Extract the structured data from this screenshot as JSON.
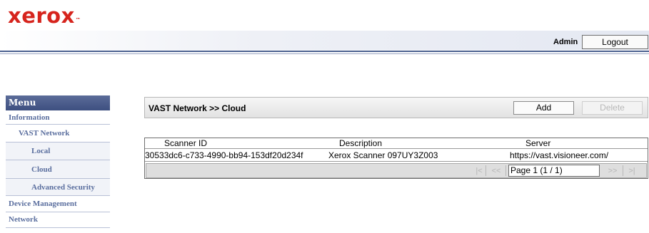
{
  "brand": {
    "logo_text": "xerox",
    "trademark": "™"
  },
  "header": {
    "user_label": "Admin",
    "logout_label": "Logout"
  },
  "sidebar": {
    "title": "Menu",
    "items": [
      {
        "label": "Information"
      },
      {
        "label": "VAST Network"
      },
      {
        "label": "Local"
      },
      {
        "label": "Cloud"
      },
      {
        "label": "Advanced Security"
      },
      {
        "label": "Device Management"
      },
      {
        "label": "Network"
      }
    ]
  },
  "section": {
    "title": "VAST Network >> Cloud",
    "add_label": "Add",
    "delete_label": "Delete"
  },
  "table": {
    "columns": [
      "Scanner ID",
      "Description",
      "Server"
    ],
    "rows": [
      [
        "30533dc6-c733-4990-bb94-153df20d234f",
        "Xerox  Scanner 097UY3Z003",
        "https://vast.visioneer.com/"
      ]
    ]
  },
  "pager": {
    "first": "|<",
    "prev": "<<",
    "page_value": "Page 1 (1 / 1)",
    "next": ">>",
    "last": ">|"
  },
  "colors": {
    "brand_red": "#d6241d",
    "menu_head": "#4a5b8c",
    "menu_text": "#5a6e9e"
  }
}
